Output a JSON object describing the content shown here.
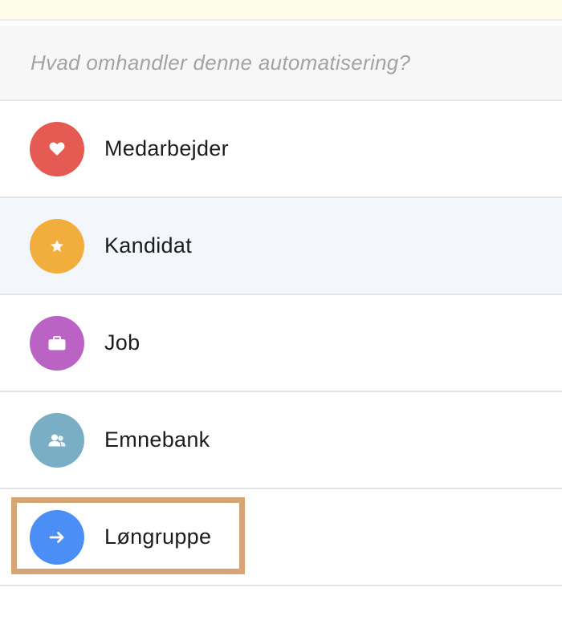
{
  "prompt": {
    "placeholder": "Hvad omhandler denne automatisering?"
  },
  "options": [
    {
      "label": "Medarbejder",
      "icon": "heart-icon",
      "color": "#e55a53",
      "hovered": false,
      "highlighted": false
    },
    {
      "label": "Kandidat",
      "icon": "star-icon",
      "color": "#f2ae3c",
      "hovered": true,
      "highlighted": false
    },
    {
      "label": "Job",
      "icon": "briefcase-icon",
      "color": "#bb63c4",
      "hovered": false,
      "highlighted": false
    },
    {
      "label": "Emnebank",
      "icon": "people-icon",
      "color": "#7aaec5",
      "hovered": false,
      "highlighted": false
    },
    {
      "label": "Løngruppe",
      "icon": "arrow-right-icon",
      "color": "#4b8ef6",
      "hovered": false,
      "highlighted": true
    }
  ],
  "colors": {
    "highlight_border": "#d7a475",
    "banner": "#fdfde9",
    "hover_row": "#f3f6fb"
  }
}
